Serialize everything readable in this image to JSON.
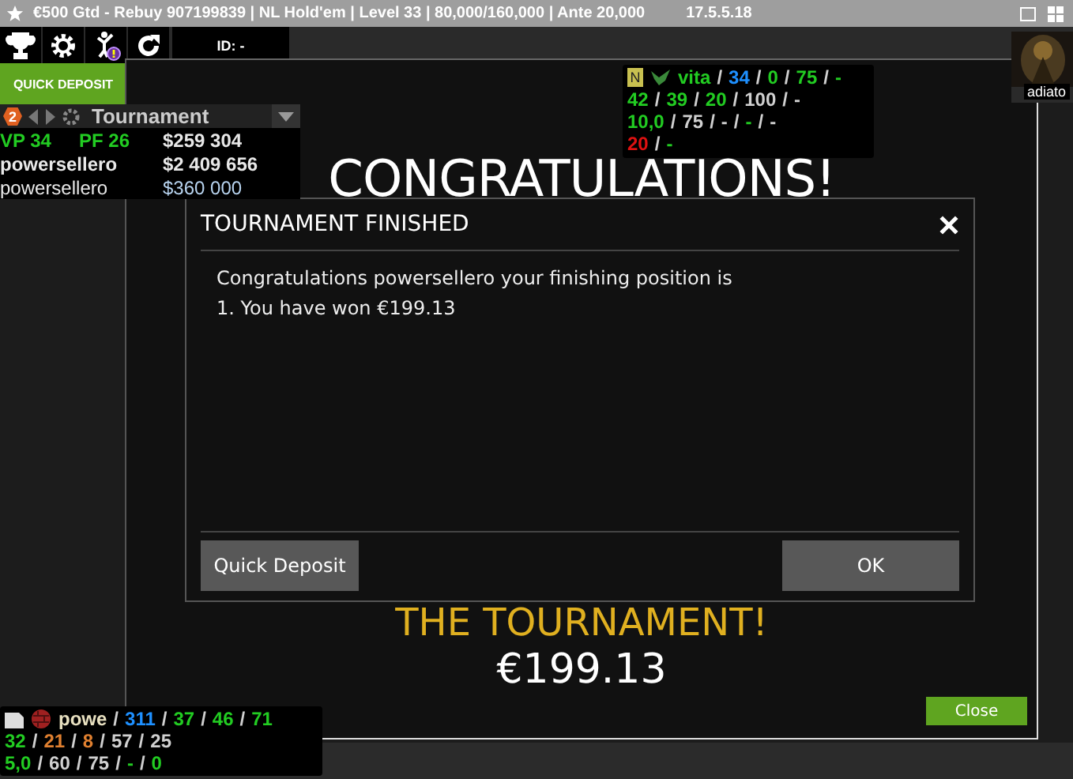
{
  "window": {
    "title": "€500 Gtd - Rebuy 907199839 | NL Hold'em | Level 33 | 80,000/160,000 | Ante 20,000",
    "version": "17.5.5.18"
  },
  "toolbar": {
    "id_label": "ID: -",
    "quick_deposit": "QUICK DEPOSIT"
  },
  "tournament_panel": {
    "badge": "2",
    "title": "Tournament",
    "rows": [
      {
        "bold": true,
        "cells": [
          {
            "text": "VP 34",
            "color": "#22cc22"
          },
          {
            "text": "PF 26",
            "color": "#22cc22"
          },
          {
            "text": "$259 304",
            "color": "#e8e8e8"
          }
        ]
      },
      {
        "bold": true,
        "cells": [
          {
            "text": "powersellero",
            "color": "#e8e8e8"
          },
          {
            "text": "$2 409 656",
            "color": "#e8e8e8"
          }
        ]
      },
      {
        "bold": false,
        "cells": [
          {
            "text": "powersellero",
            "color": "#e8e8e8"
          },
          {
            "text": "$360 000",
            "color": "#b8d4f0"
          }
        ]
      }
    ]
  },
  "hud_top": {
    "badge": "N",
    "lines": [
      [
        {
          "text": "vita",
          "color": "#22cc22"
        },
        {
          "text": "/",
          "color": "#d0d0d0"
        },
        {
          "text": "34",
          "color": "#1e90ff"
        },
        {
          "text": "/",
          "color": "#d0d0d0"
        },
        {
          "text": "0",
          "color": "#22cc22"
        },
        {
          "text": "/",
          "color": "#d0d0d0"
        },
        {
          "text": "75",
          "color": "#22cc22"
        },
        {
          "text": "/",
          "color": "#d0d0d0"
        },
        {
          "text": "-",
          "color": "#22cc22"
        }
      ],
      [
        {
          "text": "42",
          "color": "#22cc22"
        },
        {
          "text": "/",
          "color": "#d0d0d0"
        },
        {
          "text": "39",
          "color": "#22cc22"
        },
        {
          "text": "/",
          "color": "#d0d0d0"
        },
        {
          "text": "20",
          "color": "#22cc22"
        },
        {
          "text": "/",
          "color": "#d0d0d0"
        },
        {
          "text": "100",
          "color": "#d0d0d0"
        },
        {
          "text": "/",
          "color": "#d0d0d0"
        },
        {
          "text": "-",
          "color": "#d0d0d0"
        }
      ],
      [
        {
          "text": "10,0",
          "color": "#22cc22"
        },
        {
          "text": "/",
          "color": "#d0d0d0"
        },
        {
          "text": "75",
          "color": "#d0d0d0"
        },
        {
          "text": "/",
          "color": "#d0d0d0"
        },
        {
          "text": "-",
          "color": "#d0d0d0"
        },
        {
          "text": "/",
          "color": "#d0d0d0"
        },
        {
          "text": "-",
          "color": "#22cc22"
        },
        {
          "text": "/",
          "color": "#d0d0d0"
        },
        {
          "text": "-",
          "color": "#d0d0d0"
        }
      ],
      [
        {
          "text": "20",
          "color": "#dd1111"
        },
        {
          "text": "/",
          "color": "#d0d0d0"
        },
        {
          "text": "-",
          "color": "#22cc22"
        }
      ]
    ]
  },
  "hud_bottom": {
    "lines": [
      [
        {
          "text": "powe",
          "color": "#e8e0c0"
        },
        {
          "text": "/",
          "color": "#d0d0d0"
        },
        {
          "text": "311",
          "color": "#1e90ff"
        },
        {
          "text": "/",
          "color": "#d0d0d0"
        },
        {
          "text": "37",
          "color": "#22cc22"
        },
        {
          "text": "/",
          "color": "#d0d0d0"
        },
        {
          "text": "46",
          "color": "#22cc22"
        },
        {
          "text": "/",
          "color": "#d0d0d0"
        },
        {
          "text": "71",
          "color": "#22cc22"
        }
      ],
      [
        {
          "text": "32",
          "color": "#22cc22"
        },
        {
          "text": "/",
          "color": "#d0d0d0"
        },
        {
          "text": "21",
          "color": "#e08030"
        },
        {
          "text": "/",
          "color": "#d0d0d0"
        },
        {
          "text": "8",
          "color": "#e08030"
        },
        {
          "text": "/",
          "color": "#d0d0d0"
        },
        {
          "text": "57",
          "color": "#d0d0d0"
        },
        {
          "text": "/",
          "color": "#d0d0d0"
        },
        {
          "text": "25",
          "color": "#d0d0d0"
        }
      ],
      [
        {
          "text": "5,0",
          "color": "#22cc22"
        },
        {
          "text": "/",
          "color": "#d0d0d0"
        },
        {
          "text": "60",
          "color": "#d0d0d0"
        },
        {
          "text": "/",
          "color": "#d0d0d0"
        },
        {
          "text": "75",
          "color": "#d0d0d0"
        },
        {
          "text": "/",
          "color": "#d0d0d0"
        },
        {
          "text": "-",
          "color": "#22cc22"
        },
        {
          "text": "/",
          "color": "#d0d0d0"
        },
        {
          "text": "0",
          "color": "#22cc22"
        }
      ]
    ]
  },
  "player": {
    "name": "adiato"
  },
  "result": {
    "heading": "CONGRATULATIONS!",
    "subheading": "THE TOURNAMENT!",
    "amount": "€199.13",
    "close": "Close"
  },
  "dialog": {
    "title": "TOURNAMENT FINISHED",
    "message": "Congratulations powersellero your finishing position is 1. You have won €199.13",
    "buttons": [
      "Quick Deposit",
      "OK"
    ]
  }
}
